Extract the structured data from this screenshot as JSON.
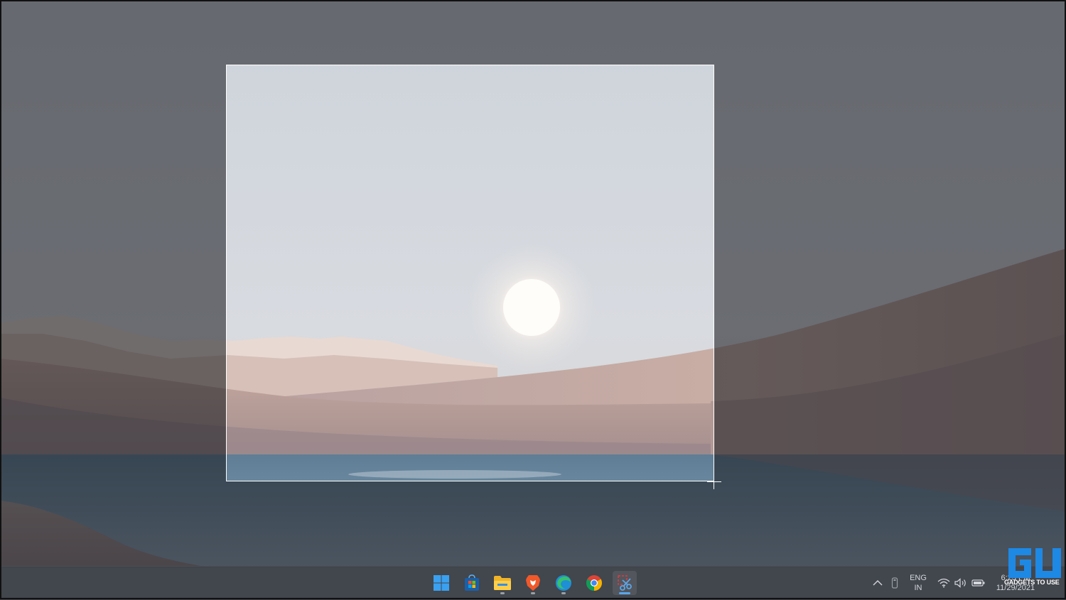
{
  "snip": {
    "overlay": "rectangle-snip-selection"
  },
  "taskbar": {
    "apps": [
      {
        "name": "start-button",
        "icon": "windows-logo-icon"
      },
      {
        "name": "microsoft-store",
        "icon": "store-icon"
      },
      {
        "name": "file-explorer",
        "icon": "folder-icon"
      },
      {
        "name": "brave-browser",
        "icon": "brave-lion-icon"
      },
      {
        "name": "microsoft-edge",
        "icon": "edge-icon"
      },
      {
        "name": "google-chrome",
        "icon": "chrome-icon"
      },
      {
        "name": "snipping-tool",
        "icon": "scissors-icon"
      }
    ],
    "tray": {
      "language_line1": "ENG",
      "language_line2": "IN",
      "time": "6:23 PM",
      "date": "11/29/2021"
    }
  },
  "watermark": {
    "text": "GADGETS TO USE"
  },
  "colors": {
    "accent_blue": "#3aa0f0",
    "taskbar": "#40444a",
    "selection_border": "#ffffff"
  }
}
